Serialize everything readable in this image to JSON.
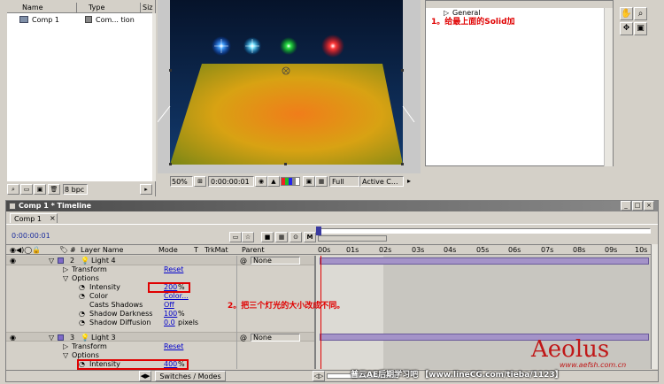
{
  "project_panel": {
    "col_name": "Name",
    "col_type": "Type",
    "col_size": "Siz",
    "item_name": "Comp 1",
    "item_type": "Com... tion",
    "bpc": "8 bpc"
  },
  "comp_viewer": {
    "zoom": "50%",
    "timecode": "0:00:00:01",
    "resolution": "Full",
    "camera": "Active C..."
  },
  "effects_panel": {
    "general": "General",
    "annotation1": "1。给最上面的Solid加"
  },
  "timeline": {
    "window_title": "Comp 1 * Timeline",
    "tab": "Comp 1",
    "current_time": "0:00:00:01",
    "headers": {
      "layer_name": "Layer Name",
      "mode": "Mode",
      "t": "T",
      "trkmat": "TrkMat",
      "parent": "Parent"
    },
    "ruler": [
      "00s",
      "01s",
      "02s",
      "03s",
      "04s",
      "05s",
      "06s",
      "07s",
      "08s",
      "09s",
      "10s"
    ],
    "rows": [
      {
        "num": "2",
        "name": "Light 4",
        "parent": "None"
      },
      {
        "name": "Transform",
        "value": "Reset"
      },
      {
        "name": "Options"
      },
      {
        "name": "Intensity",
        "value": "200",
        "unit": "%"
      },
      {
        "name": "Color",
        "value": "Color..."
      },
      {
        "name": "Casts Shadows",
        "value": "Off"
      },
      {
        "name": "Shadow Darkness",
        "value": "100",
        "unit": "%"
      },
      {
        "name": "Shadow Diffusion",
        "value": "0.0",
        "unit": "pixels"
      },
      {
        "num": "3",
        "name": "Light 3",
        "parent": "None"
      },
      {
        "name": "Transform",
        "value": "Reset"
      },
      {
        "name": "Options"
      },
      {
        "name": "Intensity",
        "value": "400",
        "unit": "%"
      }
    ],
    "annotation2": "2。把三个灯光的大小改成不同。",
    "switches_modes": "Switches / Modes"
  },
  "watermark": {
    "brand": "Aeolus",
    "site": "www.aefsh.com.cn",
    "footer": "普云AE后期学习吧 【www.lineCG.com/tieba/1123】"
  },
  "colors": {
    "accent_red": "#ff0000",
    "value_blue": "#0000cc",
    "timeline_bar": "#a493c8",
    "title_bar": "#0a246a"
  }
}
